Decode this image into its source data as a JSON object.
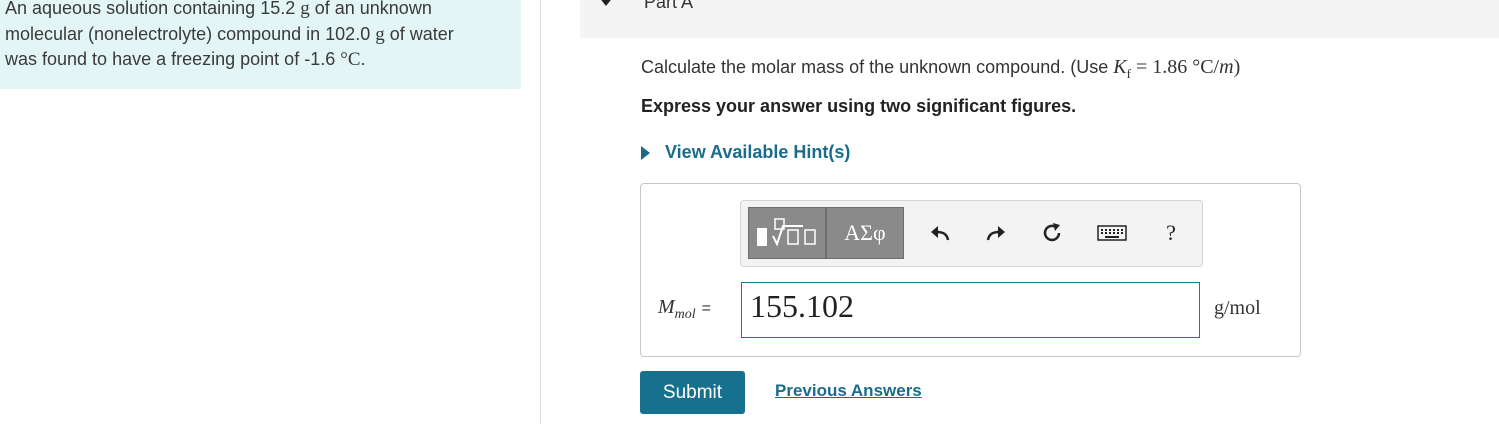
{
  "problem": {
    "line1_a": "An aqueous solution containing 15.2 ",
    "line1_unit": "g",
    "line1_b": " of an unknown",
    "line2_a": "molecular (nonelectrolyte) compound in 102.0 ",
    "line2_unit": "g",
    "line2_b": " of water",
    "line3_a": "was found to have a freezing point of -1.6 ",
    "line3_unit": "°C",
    "line3_b": "."
  },
  "part": {
    "title": "Part A"
  },
  "question": {
    "text": "Calculate the molar mass of the unknown compound. (Use ",
    "kf_symbol": "K",
    "kf_sub": "f",
    "kf_value": " = 1.86 °C/",
    "kf_m": "m",
    "close": ")"
  },
  "instruction": "Express your answer using two significant figures.",
  "hints": {
    "label": "View Available Hint(s)"
  },
  "toolbar": {
    "greek_label": "ΑΣφ",
    "help_label": "?",
    "icons": [
      "templates-icon",
      "greek-letters-icon",
      "undo-icon",
      "redo-icon",
      "reset-icon",
      "keyboard-icon",
      "help-icon"
    ]
  },
  "answer": {
    "label_var": "M",
    "label_sub": "mol",
    "label_eq": "=",
    "value": "155.102",
    "unit": "g/mol"
  },
  "actions": {
    "submit_label": "Submit",
    "previous_answers_label": "Previous Answers"
  },
  "colors": {
    "problem_bg": "#e3f5f5",
    "accent": "#16718f",
    "link": "#1a6c8a"
  }
}
